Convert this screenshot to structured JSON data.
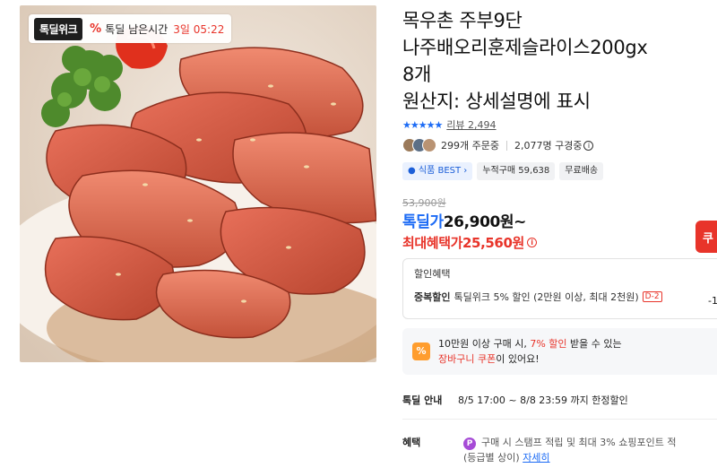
{
  "badge": {
    "logo": "톡딜위크",
    "pct_symbol": "%",
    "remaining_label": "톡딜 남은시간",
    "remaining_time": "3일 05:22"
  },
  "product": {
    "title_lines": [
      "목우촌 주부9단",
      "나주배오리훈제슬라이스200gx",
      "8개",
      "원산지: 상세설명에 표시"
    ]
  },
  "rating": {
    "stars": "★★★★★",
    "value": 4.9,
    "review_label": "리뷰 2,494"
  },
  "social": {
    "orders": "299개 주문중",
    "subscribers": "2,077명 구경중"
  },
  "chips": [
    {
      "label": "식품 BEST",
      "accent": "#1c5fd8"
    },
    {
      "label": "누적구매 59,638"
    },
    {
      "label": "무료배송"
    }
  ],
  "price": {
    "original": "53,900원",
    "deal_label": "톡딜가",
    "deal_price": "26,900원~",
    "max_label": "최대혜택가",
    "max_price": "25,560원",
    "coupon_button": "쿠"
  },
  "discount": {
    "header": "할인혜택",
    "line_label": "중복할인",
    "line_text": "톡딜위크 5% 할인 (2만원 이상, 최대 2천원)",
    "line_tag": "D-2",
    "amount": "-1"
  },
  "cart_coupon": {
    "icon": "%",
    "line1_prefix": "10만원 이상 구매 시, ",
    "line1_highlight": "7% 할인",
    "line1_suffix": " 받을 수 있는",
    "line2_highlight": "장바구니 쿠폰",
    "line2_suffix": "이 있어요!"
  },
  "deal_notice": {
    "label": "톡딜 안내",
    "text": "8/5 17:00 ~ 8/8 23:59 까지 한정할인"
  },
  "perks": {
    "label": "혜택",
    "icon": "P",
    "line1": "구매 시 스탬프 적립 및 최대 3% 쇼핑포인트 적",
    "line2_prefix": "(등급별 상이) ",
    "link": "자세히"
  },
  "colors": {
    "accent_red": "#e8342a",
    "accent_blue": "#1c6bf5"
  }
}
